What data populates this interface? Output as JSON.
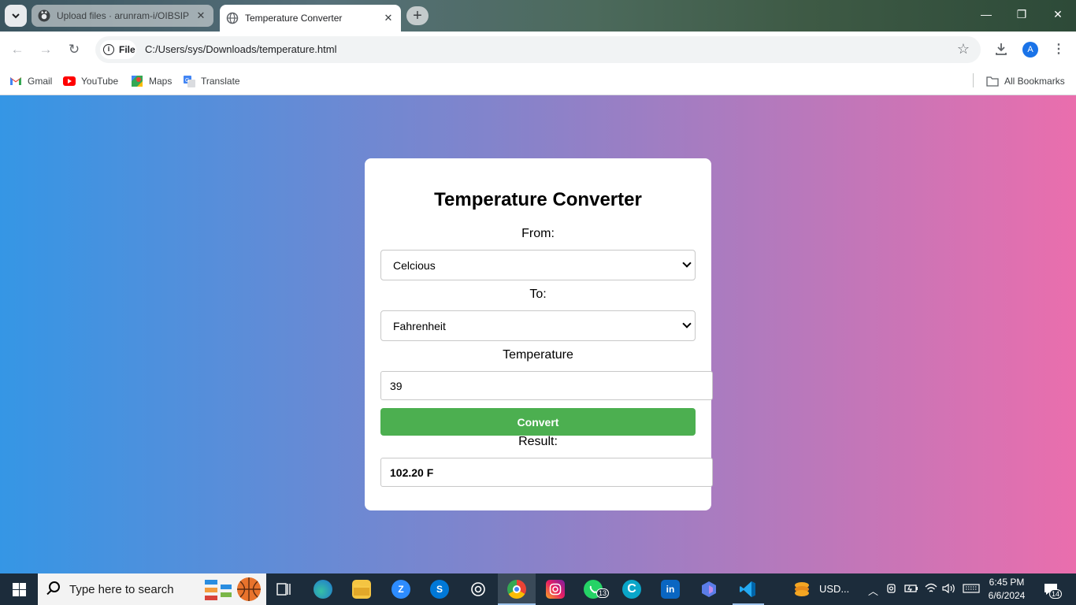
{
  "tabs": [
    {
      "title": "Upload files · arunram-i/OIBSIP",
      "active": false
    },
    {
      "title": "Temperature Converter",
      "active": true
    }
  ],
  "address_bar": {
    "scheme_chip": "File",
    "url": "C:/Users/sys/Downloads/temperature.html"
  },
  "profile_initial": "A",
  "bookmarks": [
    {
      "label": "Gmail",
      "icon": "gmail-icon"
    },
    {
      "label": "YouTube",
      "icon": "youtube-icon"
    },
    {
      "label": "Maps",
      "icon": "maps-icon"
    },
    {
      "label": "Translate",
      "icon": "translate-icon"
    }
  ],
  "all_bookmarks_label": "All Bookmarks",
  "converter": {
    "title": "Temperature Converter",
    "from_label": "From:",
    "from_value": "Celcious",
    "to_label": "To:",
    "to_value": "Fahrenheit",
    "temperature_label": "Temperature",
    "temperature_value": "39",
    "convert_label": "Convert",
    "result_label": "Result:",
    "result_value": "102.20 F",
    "button_color": "#4caf50"
  },
  "page_gradient": [
    "#3596e5",
    "#8a82c9",
    "#ea6ead"
  ],
  "taskbar": {
    "search_placeholder": "Type here to search",
    "whatsapp_badge": "13",
    "widget_label": "USD...",
    "time": "6:45 PM",
    "date": "6/6/2024",
    "notification_count": "14"
  }
}
